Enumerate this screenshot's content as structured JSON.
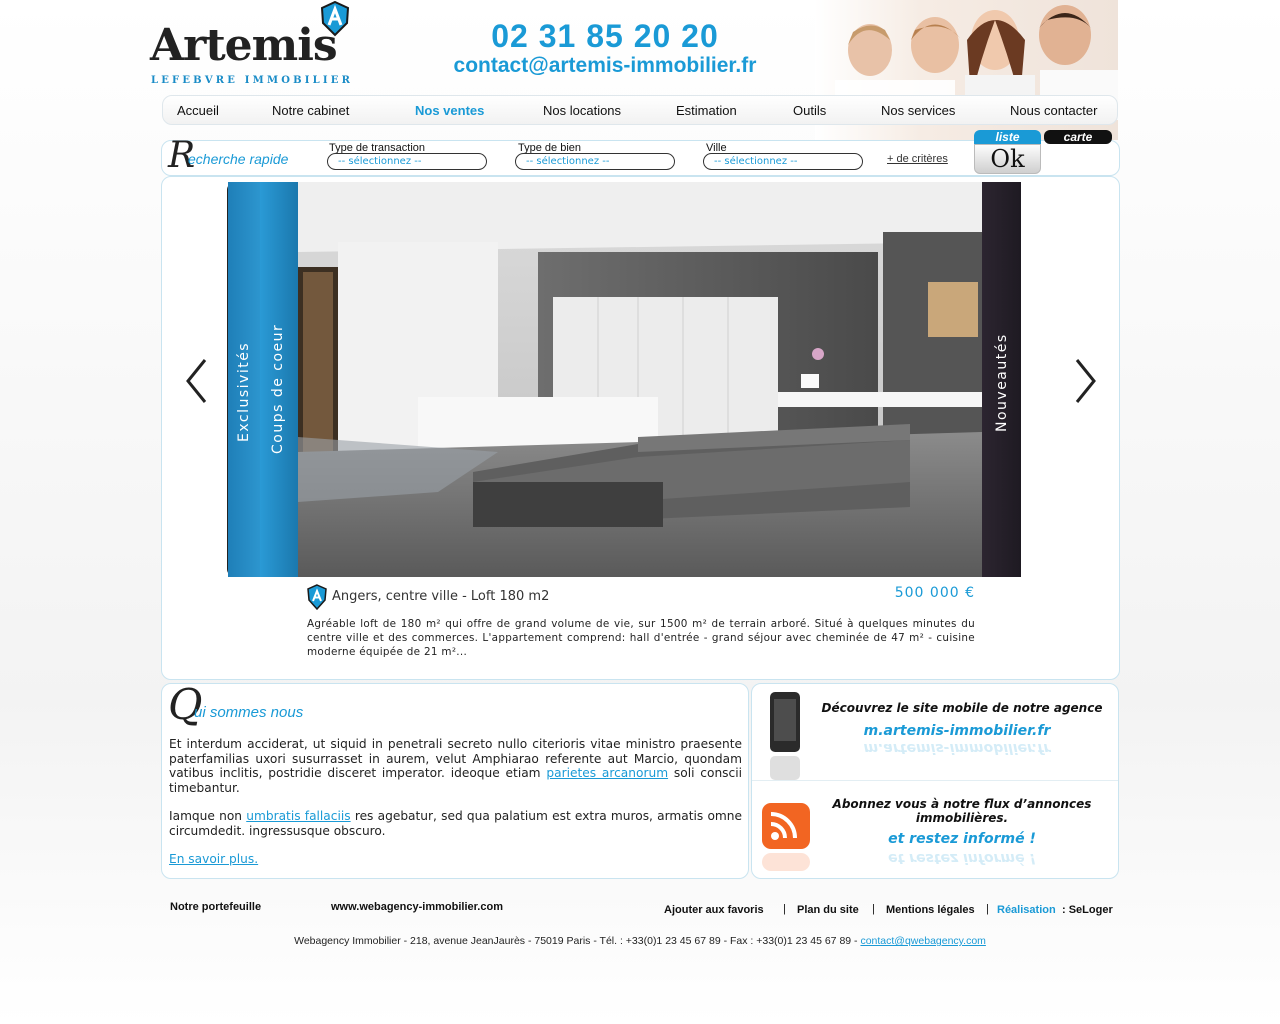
{
  "header": {
    "logo_word": "Artemis",
    "logo_sub": "LEFEBVRE IMMOBILIER",
    "phone": "02 31 85 20 20",
    "email": "contact@artemis-immobilier.fr"
  },
  "nav": {
    "items": [
      "Accueil",
      "Notre cabinet",
      "Nos ventes",
      "Nos locations",
      "Estimation",
      "Outils",
      "Nos services",
      "Nous contacter"
    ],
    "active": "Nos ventes"
  },
  "search": {
    "title_initial": "R",
    "title_rest": "echerche rapide",
    "fields": [
      {
        "label": "Type de transaction",
        "value": "-- sélectionnez --"
      },
      {
        "label": "Type de bien",
        "value": "-- sélectionnez --"
      },
      {
        "label": "Ville",
        "value": "-- sélectionnez --"
      }
    ],
    "more_criteria": "+ de critères",
    "tab_list": "liste",
    "tab_map": "carte",
    "ok_button": "Ok"
  },
  "slider": {
    "tab_exclusivites": "Exclusivités",
    "tab_coups_de_coeur": "Coups de coeur",
    "tab_nouveautes": "Nouveautés"
  },
  "property": {
    "title": "Angers, centre ville - Loft 180 m2",
    "price": "500 000 €",
    "description": "Agréable loft de 180 m² qui offre de grand volume de vie, sur 1500 m² de terrain arboré. Situé à quelques minutes du centre ville et des commerces. L'appartement comprend: hall d'entrée - grand séjour avec cheminée de 47 m² - cuisine moderne équipée de 21 m²..."
  },
  "about": {
    "title_initial": "Q",
    "title_rest": "ui sommes nous",
    "p1_a": "Et interdum acciderat, ut siquid in penetrali secreto nullo citerioris vitae ministro praesente paterfamilias uxori susurrasset in aurem, velut Amphiarao referente aut Marcio, quondam vatibus inclitis, postridie disceret imperator. ideoque etiam ",
    "p1_link": "parietes arcanorum",
    "p1_b": " soli conscii timebantur.",
    "p2_a": "Iamque non ",
    "p2_link": "umbratis fallaciis",
    "p2_b": " res agebatur, sed qua palatium est extra muros, armatis omne circumdedit. ingressusque obscuro.",
    "more_link": "En savoir plus."
  },
  "mobile": {
    "heading": "Découvrez le site mobile de notre agence",
    "url": "m.artemis-immobilier.fr"
  },
  "rss": {
    "heading": "Abonnez vous à notre flux d’annonces immobilières.",
    "cta": "et restez informé !"
  },
  "footer": {
    "portfolio": "Notre portefeuille",
    "agency_site": "www.webagency-immobilier.com",
    "favorites": "Ajouter aux favoris",
    "sitemap": "Plan du site",
    "legal": "Mentions légales",
    "realisation_label": "Réalisation",
    "realisation_value": ": SeLoger",
    "separator": "|",
    "address": "Webagency Immobilier - 218, avenue JeanJaurès - 75019 Paris - Tél. : +33(0)1 23 45 67 89 - Fax : +33(0)1 23 45 67 89 - ",
    "address_email": "contact@qwebagency.com"
  },
  "colors": {
    "accent": "#1a9ad6",
    "dark": "#111111",
    "panel_border": "#c9e4f0"
  }
}
